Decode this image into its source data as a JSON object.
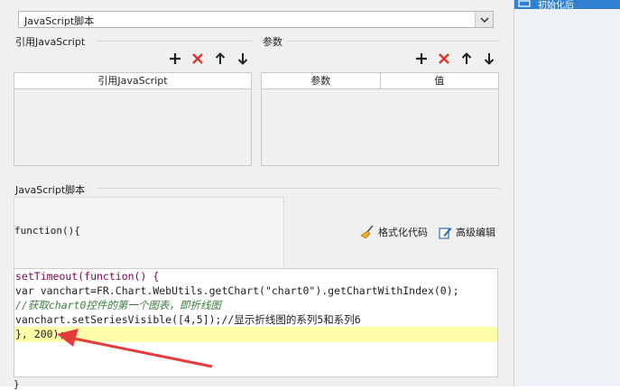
{
  "script_type": {
    "selected": "JavaScript脚本"
  },
  "ref_js": {
    "section_label": "引用JavaScript",
    "column_header": "引用JavaScript",
    "toolbar": {
      "add_label": "+",
      "delete_label": "✕",
      "up_label": "↑",
      "down_label": "↓"
    }
  },
  "params": {
    "section_label": "参数",
    "columns": [
      "参数",
      "值"
    ],
    "toolbar": {
      "add_label": "+",
      "delete_label": "✕",
      "up_label": "↑",
      "down_label": "↓"
    }
  },
  "script": {
    "section_label": "JavaScript脚本",
    "function_header": "function(){",
    "format_label": "格式化代码",
    "advanced_label": "高级编辑",
    "code_lines": [
      "setTimeout(function() {",
      "var vanchart=FR.Chart.WebUtils.getChart(\"chart0\").getChartWithIndex(0);",
      "//获取chart0控件的第一个图表，即折线图",
      "vanchart.setSeriesVisible([4,5]);//显示折线图的系列5和系列6",
      "}, 200);"
    ],
    "closing": "}"
  },
  "right_panel": {
    "label": "初始化后"
  },
  "colors": {
    "accent_blue": "#2f80d1",
    "delete_red": "#e0312b",
    "highlight_line": "#ffffaa",
    "arrow_red": "#e63b3b"
  }
}
